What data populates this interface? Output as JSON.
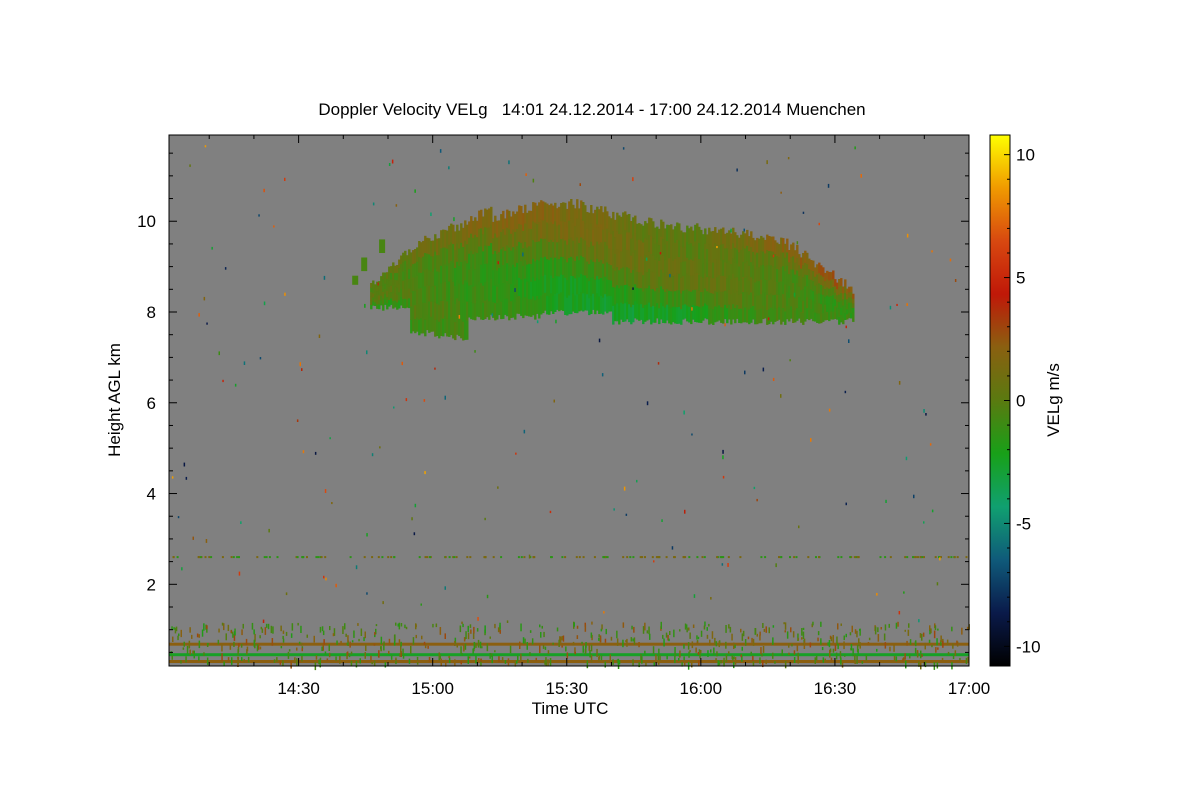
{
  "chart_data": {
    "type": "heatmap",
    "title": "Doppler Velocity VELg   14:01 24.12.2014 - 17:00 24.12.2014 Muenchen",
    "xlabel": "Time UTC",
    "ylabel": "Height AGL km",
    "xlim": [
      "14:01",
      "17:00"
    ],
    "ylim": [
      0.2,
      11.9
    ],
    "x_ticks": [
      "14:30",
      "15:00",
      "15:30",
      "16:00",
      "16:30",
      "17:00"
    ],
    "y_ticks": [
      2,
      4,
      6,
      8,
      10
    ],
    "colorbar": {
      "label": "VELg m/s",
      "range": [
        -10.8,
        10.8
      ],
      "ticks": [
        10,
        5,
        0,
        -5,
        -10
      ],
      "colors": [
        "#000000",
        "#0a1a4a",
        "#0f5a7a",
        "#10a070",
        "#18a018",
        "#5a7a10",
        "#8a6010",
        "#c01808",
        "#d84810",
        "#f09a00",
        "#ffff00"
      ]
    },
    "background_color": "#808080",
    "cloud_layer": {
      "time_start": "14:46",
      "time_end": "16:34",
      "base_km": 7.4,
      "top_km": 10.4,
      "dominant_velocity_ms": [
        -2,
        1
      ]
    },
    "boundary_layer_stripes_km": [
      0.3,
      0.45,
      0.68
    ],
    "noise_band_km": 2.6
  }
}
